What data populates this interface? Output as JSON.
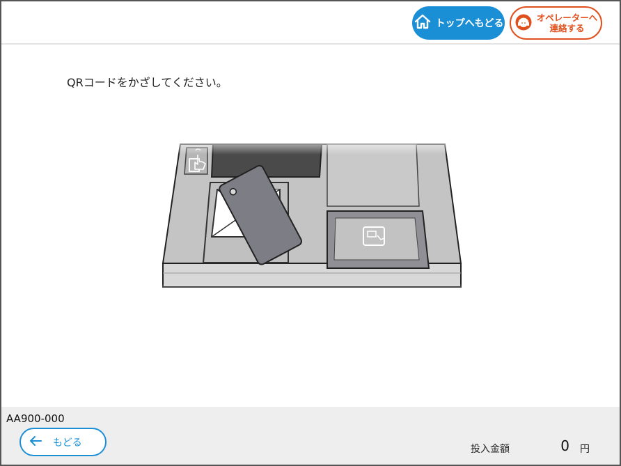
{
  "header": {
    "top_button_label": "トップへもどる",
    "operator_button_line1": "オペレーターへ",
    "operator_button_line2": "連絡する"
  },
  "main": {
    "instruction": "QRコードをかざしてください。"
  },
  "footer": {
    "device_id": "AA900-000",
    "back_button_label": "もどる",
    "amount_label": "投入金額",
    "amount_value": "0",
    "amount_unit": "円"
  },
  "icons": {
    "home": "home-icon",
    "operator": "operator-headset-icon",
    "back": "arrow-left-icon",
    "touch": "touch-hand-icon",
    "card": "card-icon"
  },
  "colors": {
    "primary_blue": "#1b8fd6",
    "operator_orange": "#e0501e",
    "footer_bg": "#eeeeee"
  }
}
